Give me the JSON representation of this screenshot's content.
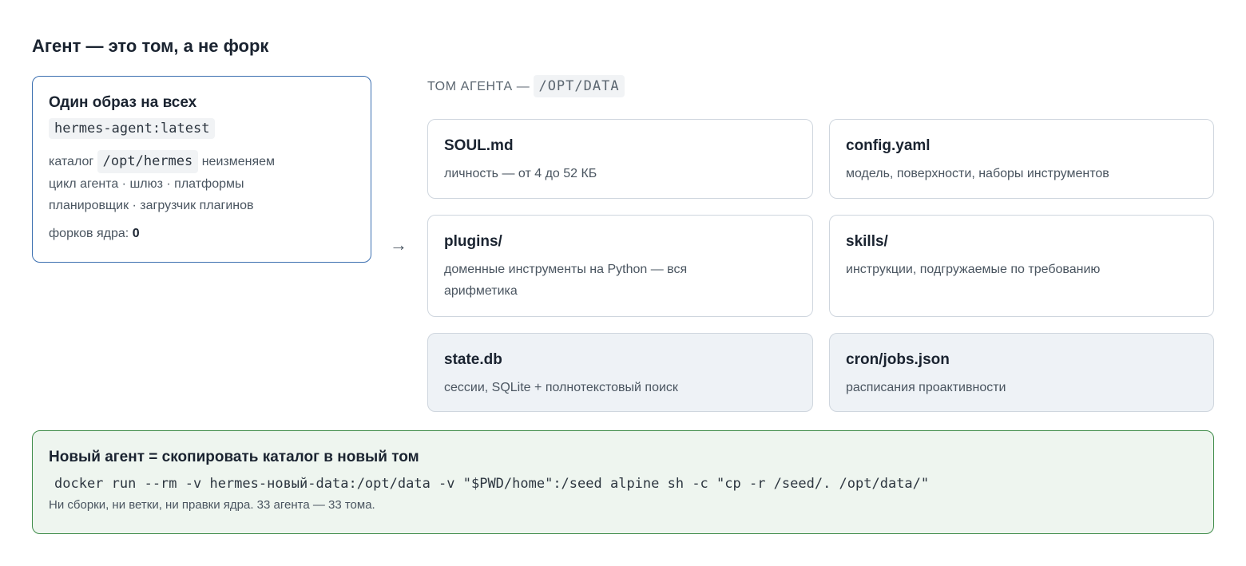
{
  "page": {
    "title": "Агент — это том, а не форк"
  },
  "image_card": {
    "title": "Один образ на всех",
    "tag": "hermes-agent:latest",
    "line1_prefix": "каталог",
    "line1_path": "/opt/hermes",
    "line1_suffix": "неизменяем",
    "line2": "цикл агента · шлюз · платформы",
    "line3": "планировщик · загрузчик плагинов",
    "forks_label": "форков ядра:",
    "forks_value": "0"
  },
  "arrow": "→",
  "volume": {
    "label": "ТОМ АГЕНТА —",
    "path": "/OPT/DATA",
    "files": [
      {
        "name": "SOUL.md",
        "desc": "личность — от 4 до 52 КБ"
      },
      {
        "name": "config.yaml",
        "desc": "модель, поверхности, наборы инструментов"
      },
      {
        "name": "plugins/",
        "desc": "доменные инструменты на Python — вся арифметика"
      },
      {
        "name": "skills/",
        "desc": "инструкции, подгружаемые по требованию"
      },
      {
        "name": "state.db",
        "desc": "сессии, SQLite + полнотекстовый поиск"
      },
      {
        "name": "cron/jobs.json",
        "desc": "расписания проактивности"
      }
    ]
  },
  "summary": {
    "title": "Новый агент = скопировать каталог в новый том",
    "command": "docker run --rm -v hermes-новый-data:/opt/data -v \"$PWD/home\":/seed alpine sh -c \"cp -r /seed/. /opt/data/\"",
    "note": "Ни сборки, ни ветки, ни правки ядра. 33 агента — 33 тома."
  }
}
